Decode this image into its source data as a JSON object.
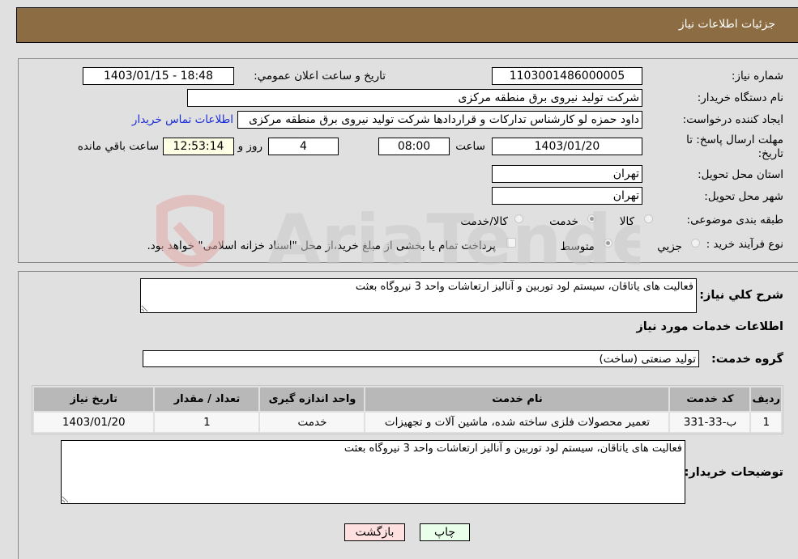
{
  "header": {
    "title": "جزئیات اطلاعات نیاز"
  },
  "form": {
    "need_number": {
      "label": "شماره نیاز:",
      "value": "1103001486000005"
    },
    "announce_datetime": {
      "label": "تاريخ و ساعت اعلان عمومي:",
      "value": "1403/01/15 - 18:48"
    },
    "buyer_org": {
      "label": "نام دستگاه خريدار:",
      "value": "شرکت تولید نیروی برق منطقه مرکزی"
    },
    "requester": {
      "label": "ايجاد کننده درخواست:",
      "value": "داود حمزه لو کارشناس تدارکات و قراردادها شرکت تولید نیروی برق منطقه مرکزی",
      "contact_link": "اطلاعات تماس خریدار"
    },
    "deadline": {
      "label_line1": "مهلت ارسال پاسخ: تا",
      "label_line2": "تاريخ:",
      "date": "1403/01/20",
      "time_label": "ساعت",
      "time": "08:00",
      "days": "4",
      "days_label": "روز و",
      "remaining": "12:53:14",
      "remaining_label": "ساعت باقي مانده"
    },
    "delivery_province": {
      "label": "استان محل تحويل:",
      "value": "تهران"
    },
    "delivery_city": {
      "label": "شهر محل تحويل:",
      "value": "تهران"
    },
    "category": {
      "label": "طبقه بندی موضوعی:",
      "options": [
        {
          "label": "کالا",
          "checked": false
        },
        {
          "label": "خدمت",
          "checked": true
        },
        {
          "label": "کالا/خدمت",
          "checked": false
        }
      ]
    },
    "purchase_type": {
      "label": "نوع فرآيند خريد :",
      "options": [
        {
          "label": "جزيي",
          "checked": false
        },
        {
          "label": "متوسط",
          "checked": true
        }
      ],
      "treasury_checkbox_label": "پرداخت تمام یا بخشی از مبلغ خرید،از محل \"اسناد خزانه اسلامی\" خواهد بود.",
      "treasury_checked": false
    }
  },
  "details": {
    "description_label": "شرح كلي نياز:",
    "description": "فعالیت های یاتاقان، سیستم لود توربین و آنالیز ارتعاشات واحد 3 نیروگاه بعثت",
    "services_heading": "اطلاعات خدمات مورد نياز",
    "service_group_label": "گروه خدمت:",
    "service_group": "تولید صنعتی (ساخت)",
    "table": {
      "headers": [
        "رديف",
        "کد خدمت",
        "نام خدمت",
        "واحد اندازه گيری",
        "تعداد / مقدار",
        "تاريخ نياز"
      ],
      "rows": [
        [
          "1",
          "ب-33-331",
          "تعمیر محصولات فلزی ساخته شده، ماشین آلات و تجهیزات",
          "خدمت",
          "1",
          "1403/01/20"
        ]
      ]
    },
    "buyer_notes_label": "توضيحات خريدار:",
    "buyer_notes": "فعالیت های یاتاقان، سیستم لود توربین و آنالیز ارتعاشات واحد 3 نیروگاه بعثت"
  },
  "buttons": {
    "print": "چاپ",
    "back": "بازگشت"
  },
  "watermark": {
    "text": "AriaTender.neT"
  },
  "colors": {
    "header_bg": "#8c6d43",
    "print_bg": "#eaffea",
    "back_bg": "#ffe0e0",
    "link": "#1a2bd8"
  }
}
